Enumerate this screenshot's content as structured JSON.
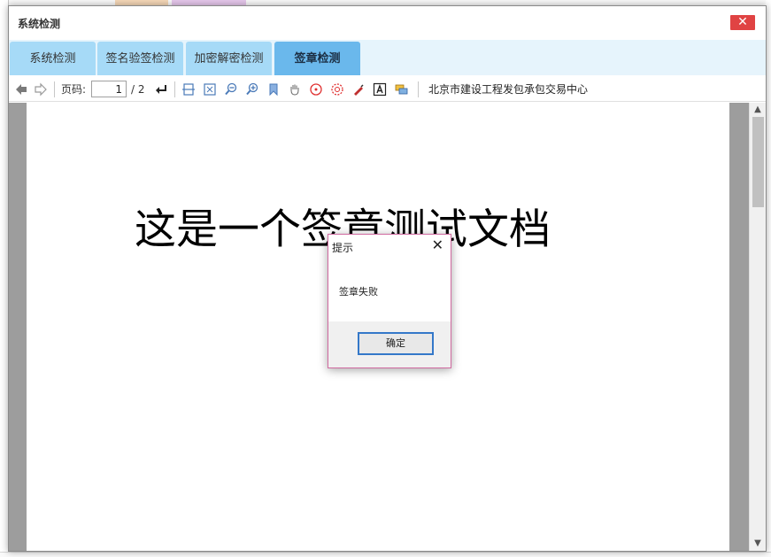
{
  "window": {
    "title": "系统检测",
    "close_label": "✕"
  },
  "tabs": [
    {
      "label": "系统检测",
      "active": false
    },
    {
      "label": "签名验签检测",
      "active": false
    },
    {
      "label": "加密解密检测",
      "active": false
    },
    {
      "label": "签章检测",
      "active": true
    }
  ],
  "toolbar": {
    "page_label": "页码:",
    "page_current": "1",
    "page_total": "/ 2",
    "org_name": "北京市建设工程发包承包交易中心"
  },
  "document": {
    "title": "这是一个签章测试文档"
  },
  "alert": {
    "title": "提示",
    "message": "签章失败",
    "ok_label": "确定"
  },
  "colors": {
    "tab": "#a6daf7",
    "tab_active": "#6ab8ec",
    "close": "#e04343",
    "ok_border": "#3478c9"
  }
}
